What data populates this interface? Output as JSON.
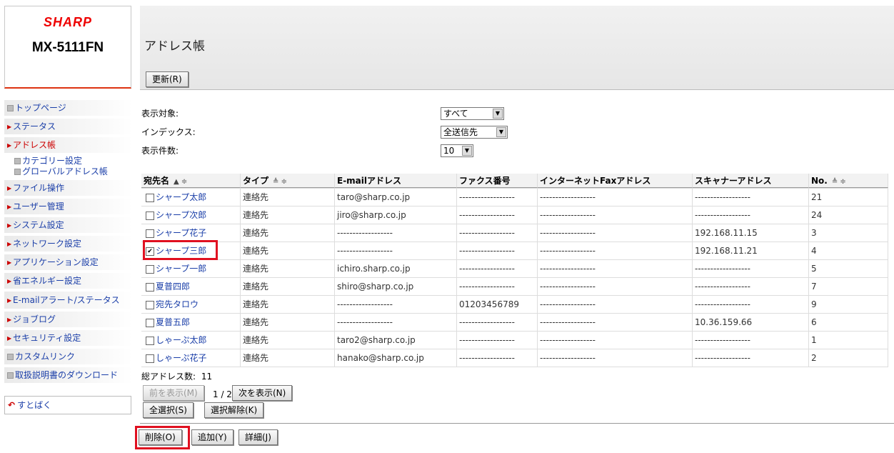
{
  "logo": {
    "brand": "SHARP",
    "model": "MX-5111FN"
  },
  "header": {
    "title": "アドレス帳",
    "refresh_label": "更新(R)"
  },
  "sidebar": {
    "items": [
      {
        "label": "トップページ",
        "marker": "square"
      },
      {
        "label": "ステータス",
        "marker": "triangle"
      },
      {
        "label": "アドレス帳",
        "marker": "triangle",
        "active": true
      },
      {
        "label": "カテゴリー設定",
        "marker": "square",
        "sub": true
      },
      {
        "label": "グローバルアドレス帳",
        "marker": "square",
        "sub": true
      },
      {
        "label": "ファイル操作",
        "marker": "triangle"
      },
      {
        "label": "ユーザー管理",
        "marker": "triangle"
      },
      {
        "label": "システム設定",
        "marker": "triangle"
      },
      {
        "label": "ネットワーク設定",
        "marker": "triangle"
      },
      {
        "label": "アプリケーション設定",
        "marker": "triangle"
      },
      {
        "label": "省エネルギー設定",
        "marker": "triangle"
      },
      {
        "label": "E-mailアラート/ステータス",
        "marker": "triangle"
      },
      {
        "label": "ジョブログ",
        "marker": "triangle"
      },
      {
        "label": "セキュリティ設定",
        "marker": "triangle"
      },
      {
        "label": "カスタムリンク",
        "marker": "square"
      },
      {
        "label": "取扱説明書のダウンロード",
        "marker": "square"
      }
    ],
    "sumaho_label": "すとばく"
  },
  "filters": {
    "display_target": {
      "label": "表示対象:",
      "value": "すべて"
    },
    "index": {
      "label": "インデックス:",
      "value": "全送信先"
    },
    "count": {
      "label": "表示件数:",
      "value": "10"
    }
  },
  "table": {
    "columns": [
      "宛先名",
      "タイプ",
      "E-mailアドレス",
      "ファクス番号",
      "インターネットFaxアドレス",
      "スキャナーアドレス",
      "No."
    ],
    "rows": [
      {
        "checked": false,
        "name": "シャープ太郎",
        "type": "連絡先",
        "email": "taro@sharp.co.jp",
        "fax": "------------------",
        "ifax": "------------------",
        "scanner": "------------------",
        "no": "21"
      },
      {
        "checked": false,
        "name": "シャープ次郎",
        "type": "連絡先",
        "email": "jiro@sharp.co.jp",
        "fax": "------------------",
        "ifax": "------------------",
        "scanner": "------------------",
        "no": "24"
      },
      {
        "checked": false,
        "name": "シャープ花子",
        "type": "連絡先",
        "email": "------------------",
        "fax": "------------------",
        "ifax": "------------------",
        "scanner": "192.168.11.15",
        "no": "3"
      },
      {
        "checked": true,
        "name": "シャープ三郎",
        "type": "連絡先",
        "email": "------------------",
        "fax": "------------------",
        "ifax": "------------------",
        "scanner": "192.168.11.21",
        "no": "4"
      },
      {
        "checked": false,
        "name": "シャープ一郎",
        "type": "連絡先",
        "email": "ichiro.sharp.co.jp",
        "fax": "------------------",
        "ifax": "------------------",
        "scanner": "------------------",
        "no": "5"
      },
      {
        "checked": false,
        "name": "夏普四郎",
        "type": "連絡先",
        "email": "shiro@sharp.co.jp",
        "fax": "------------------",
        "ifax": "------------------",
        "scanner": "------------------",
        "no": "7"
      },
      {
        "checked": false,
        "name": "宛先タロウ",
        "type": "連絡先",
        "email": "------------------",
        "fax": "01203456789",
        "ifax": "------------------",
        "scanner": "------------------",
        "no": "9"
      },
      {
        "checked": false,
        "name": "夏普五郎",
        "type": "連絡先",
        "email": "------------------",
        "fax": "------------------",
        "ifax": "------------------",
        "scanner": "10.36.159.66",
        "no": "6"
      },
      {
        "checked": false,
        "name": "しゃーぷ太郎",
        "type": "連絡先",
        "email": "taro2@sharp.co.jp",
        "fax": "------------------",
        "ifax": "------------------",
        "scanner": "------------------",
        "no": "1"
      },
      {
        "checked": false,
        "name": "しゃーぷ花子",
        "type": "連絡先",
        "email": "hanako@sharp.co.jp",
        "fax": "------------------",
        "ifax": "------------------",
        "scanner": "------------------",
        "no": "2"
      }
    ]
  },
  "footer": {
    "total_label": "総アドレス数:",
    "total_value": "11",
    "prev_label": "前を表示(M)",
    "page_info": "1 / 2",
    "next_label": "次を表示(N)",
    "select_all_label": "全選択(S)",
    "deselect_label": "選択解除(K)",
    "delete_label": "削除(O)",
    "add_label": "追加(Y)",
    "detail_label": "詳細(J)"
  },
  "colors": {
    "accent_red": "#e01020",
    "link_blue": "#1a3ea8"
  }
}
